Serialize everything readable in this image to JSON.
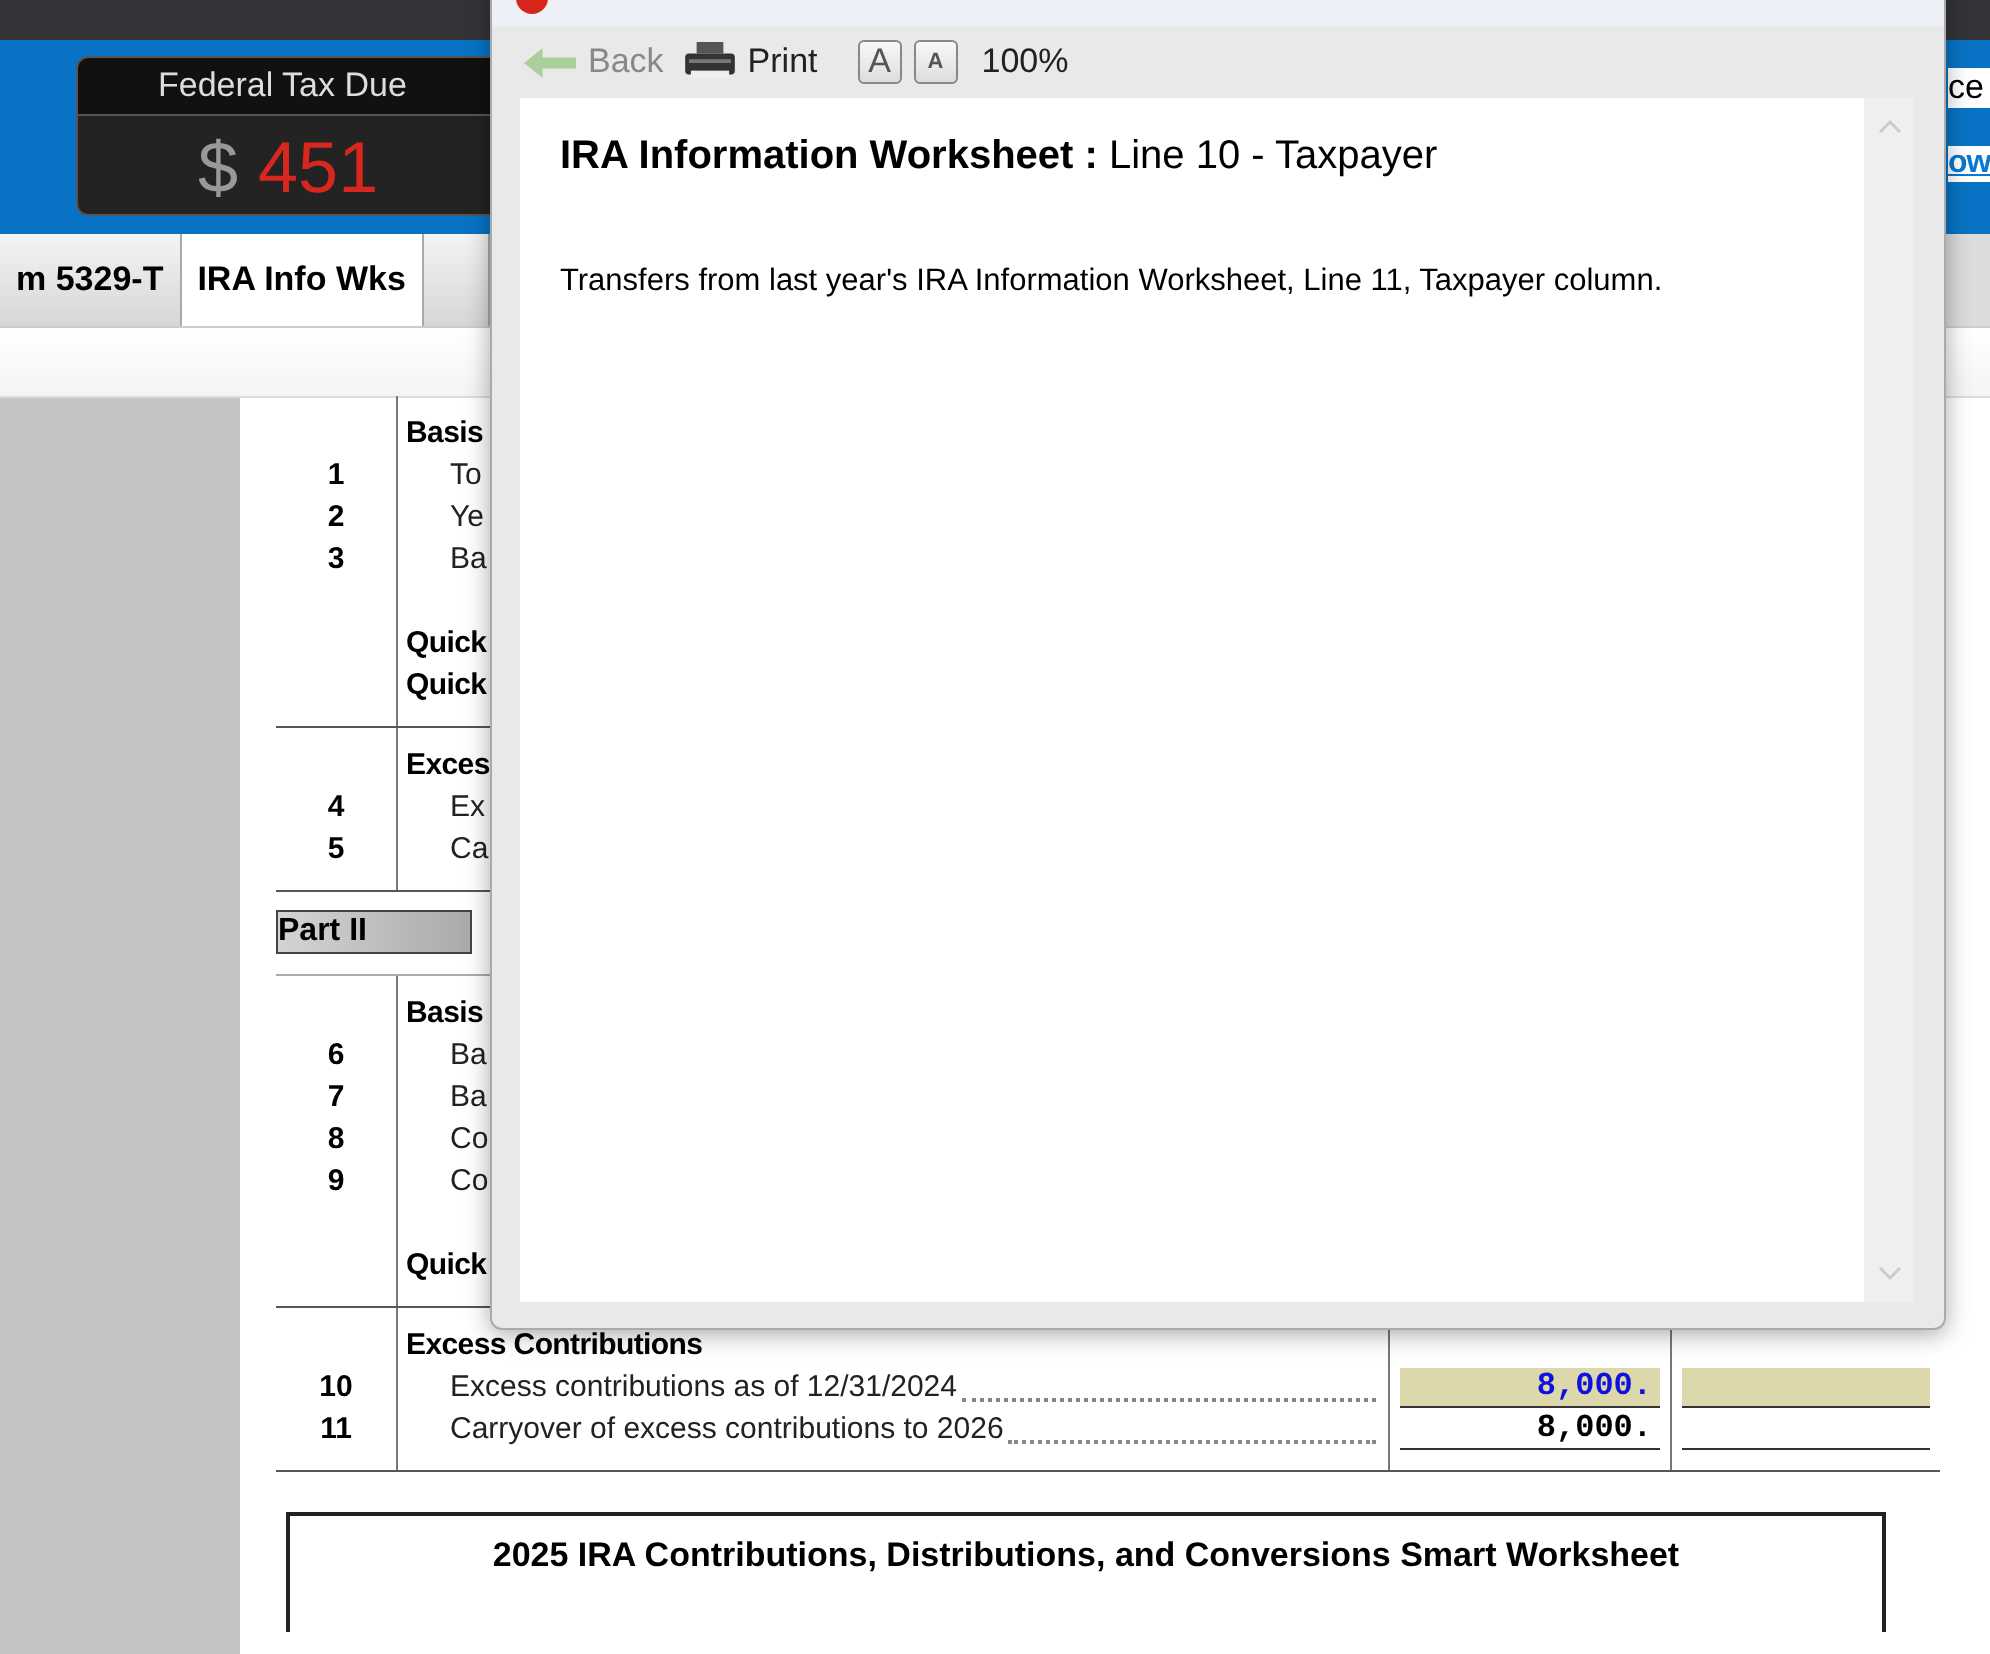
{
  "header": {
    "tax_box": {
      "title": "Federal Tax Due",
      "currency": "$",
      "amount": "451"
    },
    "right_text": "ce",
    "right_link": "ow"
  },
  "tabs": [
    {
      "label": "m 5329-T",
      "selected": false
    },
    {
      "label": "IRA Info Wks",
      "selected": true
    }
  ],
  "worksheet": {
    "blocks": [
      {
        "kind": "section",
        "rows": [
          {
            "kind": "heading",
            "text": "Basis"
          },
          {
            "kind": "line",
            "number": "1",
            "text": "To"
          },
          {
            "kind": "line",
            "number": "2",
            "text": "Ye"
          },
          {
            "kind": "line",
            "number": "3",
            "text": "Ba"
          },
          {
            "kind": "spacer"
          },
          {
            "kind": "heading",
            "text": "Quick"
          },
          {
            "kind": "heading",
            "text": "Quick"
          }
        ]
      },
      {
        "kind": "section",
        "rows": [
          {
            "kind": "heading",
            "text": "Exces"
          },
          {
            "kind": "line",
            "number": "4",
            "text": "Ex"
          },
          {
            "kind": "line",
            "number": "5",
            "text": "Ca"
          }
        ]
      },
      {
        "kind": "part",
        "text": "Part II"
      },
      {
        "kind": "section",
        "rows": [
          {
            "kind": "heading",
            "text": "Basis"
          },
          {
            "kind": "line",
            "number": "6",
            "text": "Ba"
          },
          {
            "kind": "line",
            "number": "7",
            "text": "Ba"
          },
          {
            "kind": "line",
            "number": "8",
            "text": "Co"
          },
          {
            "kind": "line",
            "number": "9",
            "text": "Co"
          },
          {
            "kind": "spacer"
          },
          {
            "kind": "heading",
            "text": "Quick"
          }
        ]
      },
      {
        "kind": "section",
        "rows": [
          {
            "kind": "heading",
            "text": "Excess Contributions"
          },
          {
            "kind": "line",
            "number": "10",
            "text": "Excess contributions as of 12/31/2024",
            "cells": [
              {
                "kind": "input",
                "value": "8,000."
              },
              {
                "kind": "input"
              }
            ]
          },
          {
            "kind": "line",
            "number": "11",
            "text": "Carryover of excess contributions to 2026",
            "cells": [
              {
                "kind": "calc",
                "value": "8,000."
              },
              {
                "kind": "calc"
              }
            ]
          }
        ]
      }
    ]
  },
  "next_worksheet": {
    "title": "2025 IRA Contributions, Distributions, and Conversions Smart Worksheet"
  },
  "popup": {
    "back": {
      "label": "Back",
      "disabled": true
    },
    "print": "Print",
    "font_buttons": [
      {
        "label": "A",
        "kind": "larger"
      },
      {
        "label": "A",
        "kind": "smaller"
      }
    ],
    "zoom": "100%",
    "title": "**IRA Information Worksheet :** Line 10 - Taxpayer",
    "text": "Transfers from last year's IRA Information Worksheet, Line 11, Taxpayer column."
  }
}
